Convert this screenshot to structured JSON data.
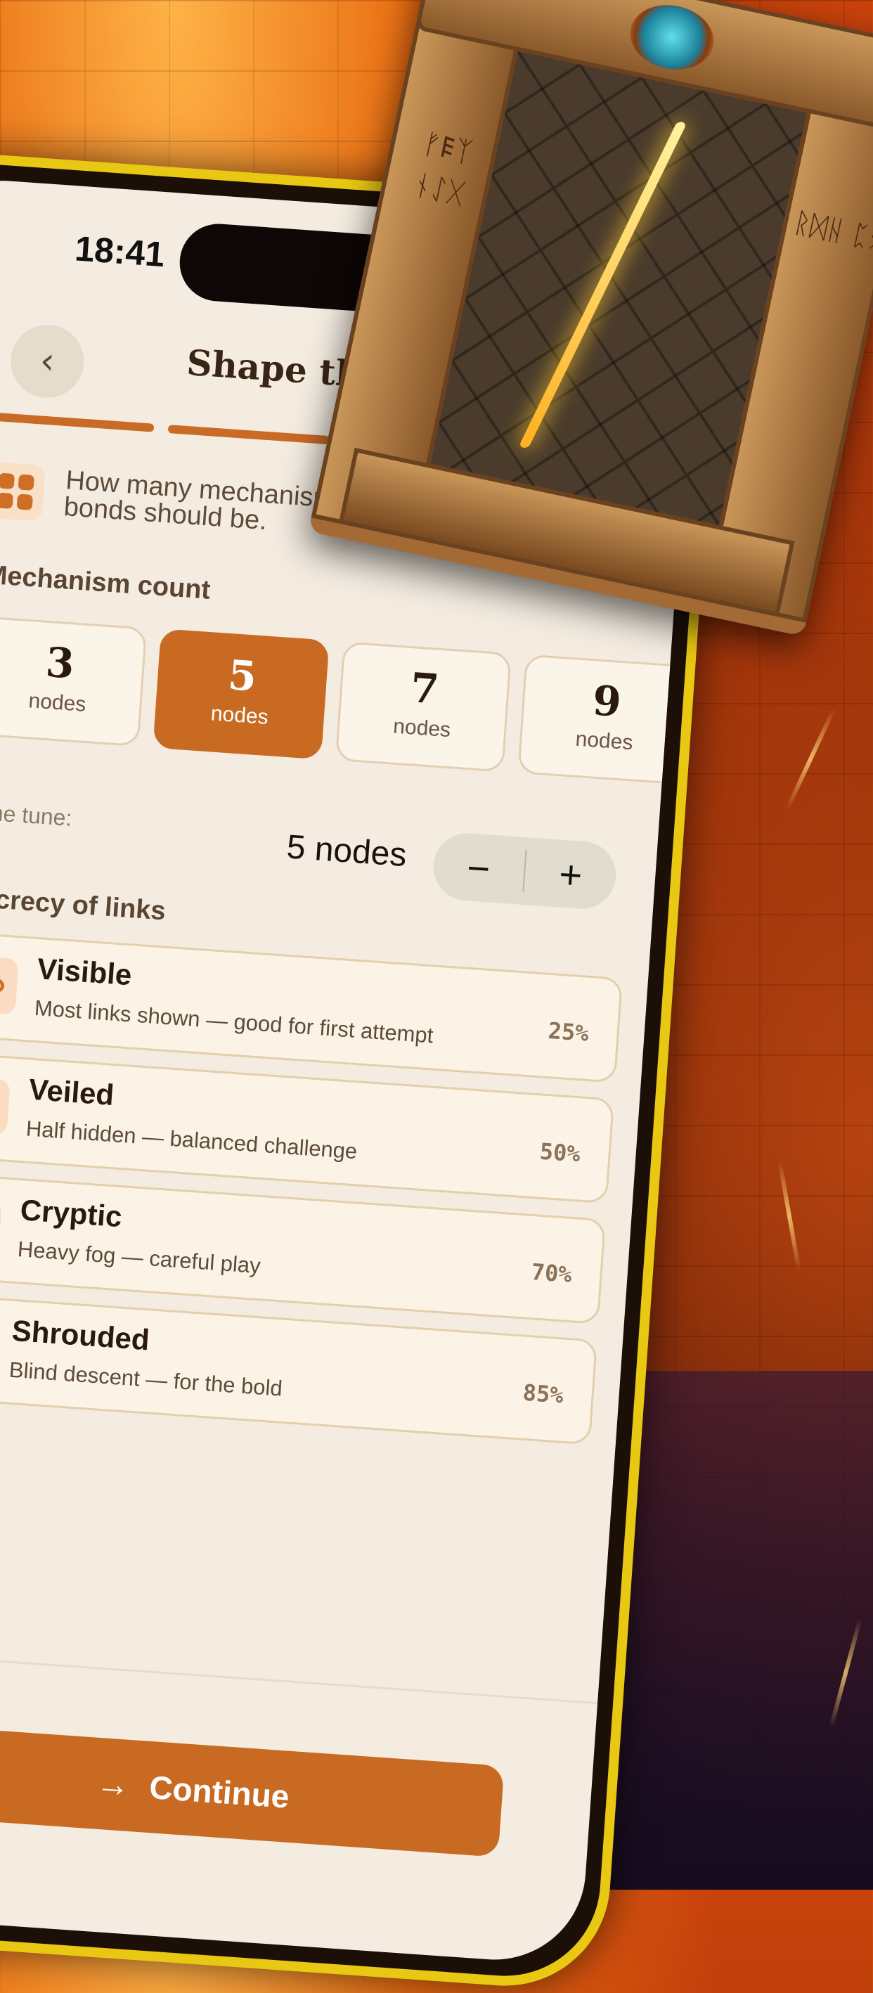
{
  "status_bar": {
    "time": "18:41"
  },
  "header": {
    "title": "Shape the"
  },
  "progress": {
    "segments": 3,
    "filled": 3
  },
  "intro": {
    "text": "How many mechanisms and how bonds should be."
  },
  "mechanism": {
    "label": "Mechanism count",
    "options": [
      {
        "value": "3",
        "unit": "nodes",
        "selected": false
      },
      {
        "value": "5",
        "unit": "nodes",
        "selected": true
      },
      {
        "value": "7",
        "unit": "nodes",
        "selected": false
      },
      {
        "value": "9",
        "unit": "nodes",
        "selected": false
      }
    ]
  },
  "fine_tune": {
    "label": "Fine tune:",
    "value": "5 nodes",
    "minus": "−",
    "plus": "+"
  },
  "secrecy": {
    "label": "Secrecy of links",
    "options": [
      {
        "name": "Visible",
        "desc": "Most links shown — good for first attempt",
        "pct": "25%"
      },
      {
        "name": "Veiled",
        "desc": "Half hidden — balanced challenge",
        "pct": "50%"
      },
      {
        "name": "Cryptic",
        "desc": "Heavy fog — careful play",
        "pct": "70%"
      },
      {
        "name": "Shrouded",
        "desc": "Blind descent — for the bold",
        "pct": "85%"
      }
    ]
  },
  "footer": {
    "continue_label": "Continue",
    "arrow": "→"
  },
  "art": {
    "glyphs_left": "ᚠ𐌄ᛉ ᚾᛇᚷ",
    "glyphs_right": "ᚱᛞᚺ ᛈᛟ"
  },
  "colors": {
    "accent": "#c96a22",
    "background": "#f4ece0",
    "frame": "#e8c812"
  }
}
